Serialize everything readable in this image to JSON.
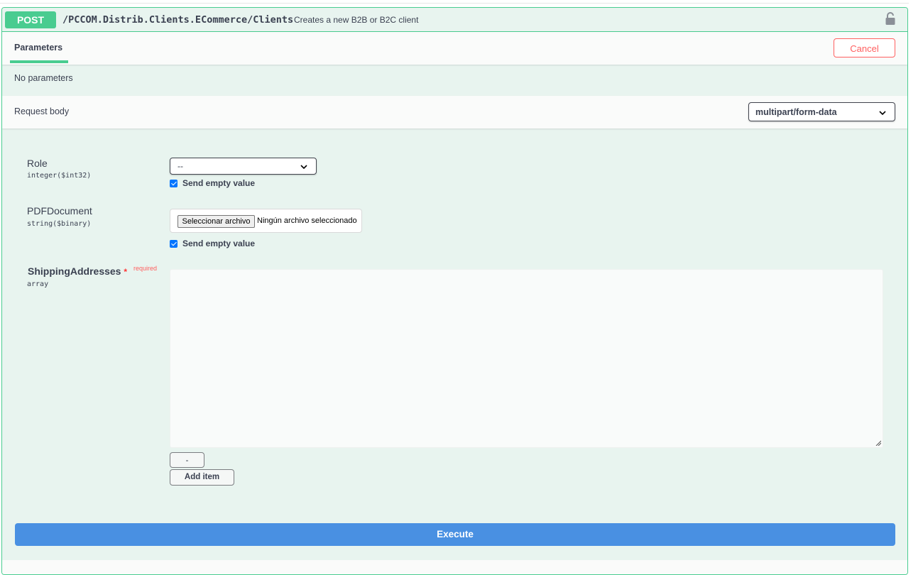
{
  "operation": {
    "method": "POST",
    "path": "/PCCOM.Distrib.Clients.ECommerce/Clients",
    "description": "Creates a new B2B or B2C client"
  },
  "tabs": {
    "parameters_label": "Parameters",
    "cancel_label": "Cancel"
  },
  "parameters": {
    "empty_text": "No parameters"
  },
  "request_body": {
    "title": "Request body",
    "content_type": "multipart/form-data"
  },
  "fields": {
    "role": {
      "name": "Role",
      "type": "integer($int32)",
      "selected": "--",
      "send_empty_label": "Send empty value"
    },
    "pdf": {
      "name": "PDFDocument",
      "type": "string($binary)",
      "file_button": "Seleccionar archivo",
      "file_status": "Ningún archivo seleccionado",
      "send_empty_label": "Send empty value"
    },
    "shipping": {
      "name": "ShippingAddresses",
      "required_marker": "*",
      "required_label": "required",
      "type": "array",
      "value": "",
      "minus_label": "-",
      "add_item_label": "Add item"
    }
  },
  "actions": {
    "execute_label": "Execute"
  },
  "colors": {
    "post_green": "#49cc90",
    "execute_blue": "#4990e2",
    "cancel_red": "#ff6060",
    "block_bg": "#e8f4ef"
  }
}
